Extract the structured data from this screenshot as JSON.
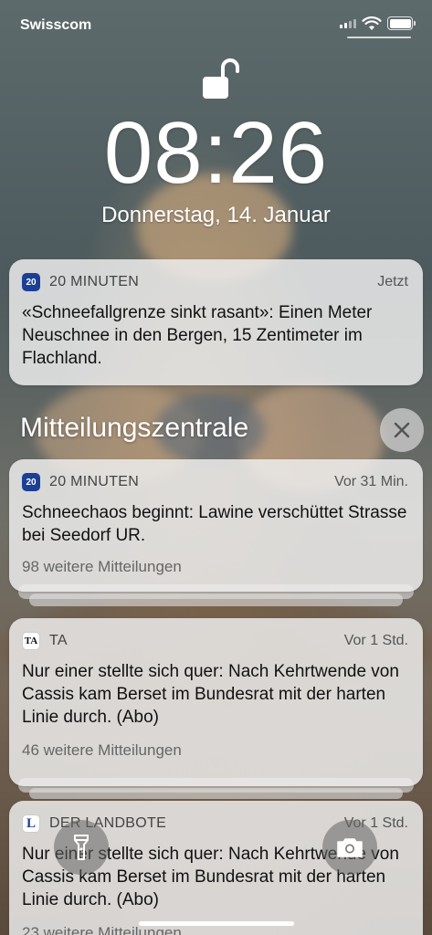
{
  "status": {
    "carrier": "Swisscom"
  },
  "lockscreen": {
    "time": "08:26",
    "date": "Donnerstag, 14. Januar"
  },
  "notifications": [
    {
      "app": "20 MINUTEN",
      "icon": "20",
      "time": "Jetzt",
      "body": "«Schneefallgrenze sinkt rasant»: Einen Meter Neuschnee in den Bergen, 15 Zentimeter im Flachland."
    }
  ],
  "center": {
    "title": "Mitteilungszentrale",
    "items": [
      {
        "app": "20 MINUTEN",
        "icon": "20",
        "time": "Vor 31 Min.",
        "body": "Schneechaos beginnt: Lawine verschüttet Strasse bei Seedorf UR.",
        "more": "98 weitere Mitteilungen"
      },
      {
        "app": "TA",
        "icon": "TA",
        "time": "Vor 1 Std.",
        "body": "Nur einer stellte sich quer: Nach Kehrtwende von Cassis kam Berset im Bundesrat mit der harten Linie durch. (Abo)",
        "more": "46 weitere Mitteilungen"
      },
      {
        "app": "DER LANDBOTE",
        "icon": "L",
        "time": "Vor 1 Std.",
        "body": "Nur einer stellte sich quer: Nach Kehrtwende von Cassis kam Berset im Bundesrat mit der harten Linie durch. (Abo)",
        "more": "23 weitere Mitteilungen"
      }
    ]
  },
  "icons": {
    "lock": "unlocked-padlock-icon",
    "close": "close-icon",
    "flashlight": "flashlight-icon",
    "camera": "camera-icon"
  },
  "colors": {
    "card_bg": "#eeeeee",
    "news_blue": "#1c3f96"
  }
}
